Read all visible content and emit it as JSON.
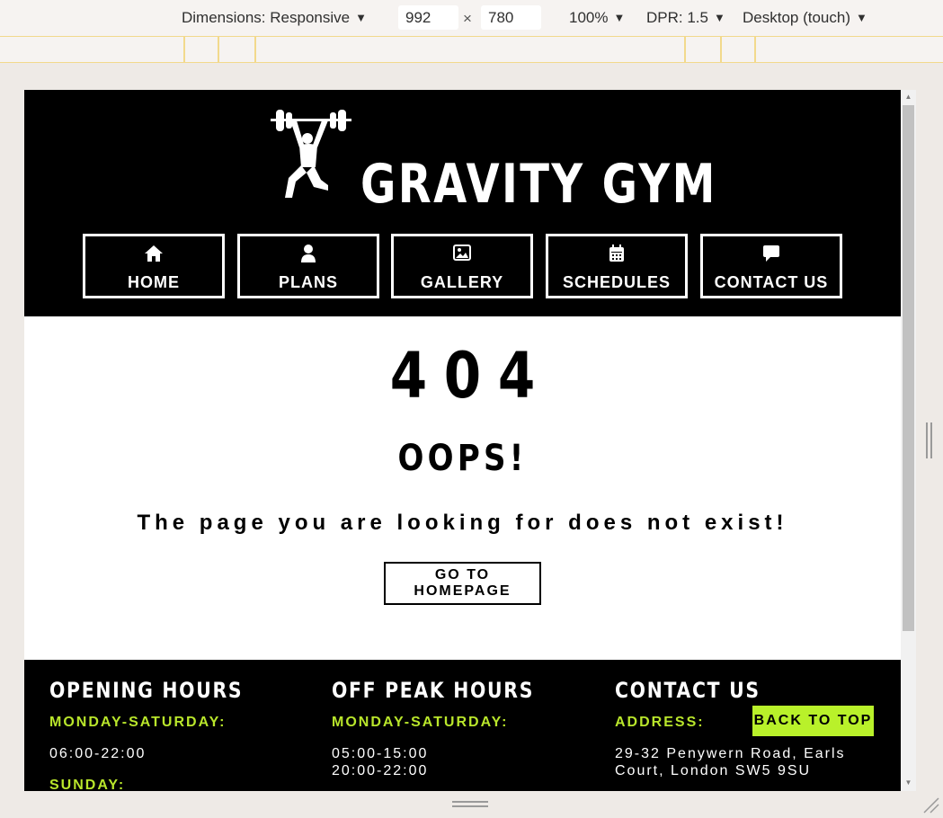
{
  "devtools": {
    "dimensions_label": "Dimensions: Responsive",
    "width_value": "992",
    "height_value": "780",
    "times": "×",
    "zoom": "100%",
    "dpr": "DPR: 1.5",
    "device_mode": "Desktop (touch)",
    "caret": "▼"
  },
  "site": {
    "brand": "GRAVITY GYM",
    "nav": [
      {
        "label": "HOME",
        "icon": "home-icon"
      },
      {
        "label": "PLANS",
        "icon": "user-icon"
      },
      {
        "label": "GALLERY",
        "icon": "image-icon"
      },
      {
        "label": "SCHEDULES",
        "icon": "calendar-icon"
      },
      {
        "label": "CONTACT US",
        "icon": "chat-icon"
      }
    ]
  },
  "error": {
    "code": "404",
    "title": "OOPS!",
    "message": "The page you are looking for does not exist!",
    "button": "GO TO HOMEPAGE"
  },
  "footer": {
    "opening": {
      "heading": "OPENING HOURS",
      "label1": "MONDAY-SATURDAY:",
      "line1": "06:00-22:00",
      "label2": "SUNDAY:"
    },
    "offpeak": {
      "heading": "OFF PEAK HOURS",
      "label1": "MONDAY-SATURDAY:",
      "line1": "05:00-15:00",
      "line2": "20:00-22:00"
    },
    "contact": {
      "heading": "CONTACT US",
      "label1": "ADDRESS:",
      "line1": "29-32 Penywern Road, Earls",
      "line2": "Court, London SW5 9SU"
    },
    "back_to_top": "BACK TO TOP"
  },
  "colors": {
    "accent": "#b9f12a",
    "header_bg": "#000000"
  }
}
